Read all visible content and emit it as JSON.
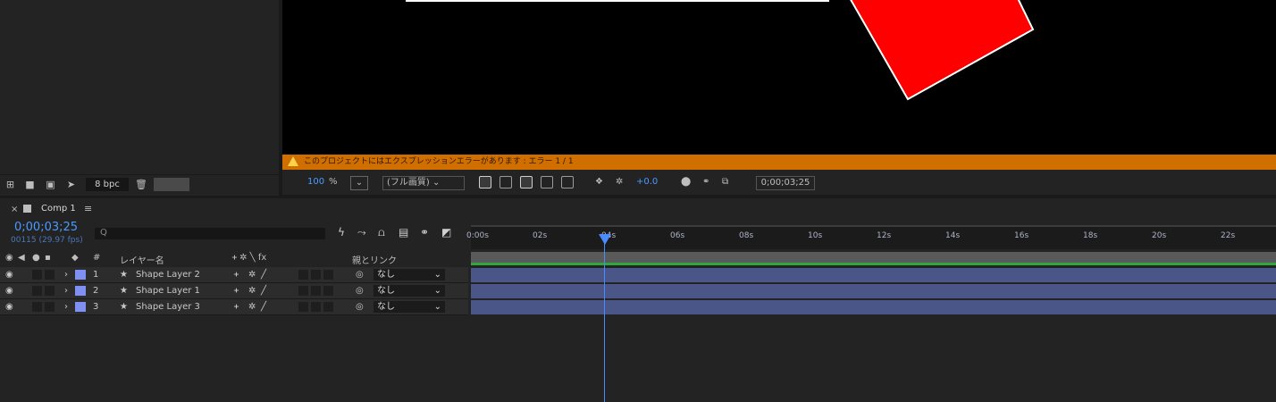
{
  "project": {
    "bpc_label": "8 bpc",
    "icons": [
      "interpret-footage-icon",
      "folder-icon",
      "new-comp-icon",
      "flowchart-icon",
      "trash-icon"
    ]
  },
  "viewer": {
    "warning": "このプロジェクトにはエクスプレッションエラーがあります : エラー 1 / 1",
    "zoom_value": "100",
    "zoom_unit": "%",
    "resolution": "(フル画質)",
    "exposure": "+0.0",
    "timecode": "0;00;03;25",
    "colors": {
      "bg": "#000000",
      "shape_fill": "#ff0000",
      "shape_stroke": "#ffffff"
    }
  },
  "timeline": {
    "close_glyph": "×",
    "comp_tab": "Comp 1",
    "menu_glyph": "≡",
    "timecode": "0;00;03;25",
    "frame_info": "00115 (29.97 fps)",
    "search_glyph": "Q",
    "columns": {
      "hash": "#",
      "layer_name": "レイヤー名",
      "switches": "ᚐ ✲ ╲ fx",
      "parent": "親とリンク"
    },
    "ruler_ticks": [
      "0:00s",
      "02s",
      "04s",
      "06s",
      "08s",
      "10s",
      "12s",
      "14s",
      "16s",
      "18s",
      "20s",
      "22s"
    ],
    "layers": [
      {
        "index": "1",
        "name": "Shape Layer 2",
        "parent": "なし"
      },
      {
        "index": "2",
        "name": "Shape Layer 1",
        "parent": "なし"
      },
      {
        "index": "3",
        "name": "Shape Layer 3",
        "parent": "なし"
      }
    ],
    "colors": {
      "playhead": "#4a8cff",
      "layer_bar": "#4a5688",
      "label": "#7f8ff2"
    }
  }
}
